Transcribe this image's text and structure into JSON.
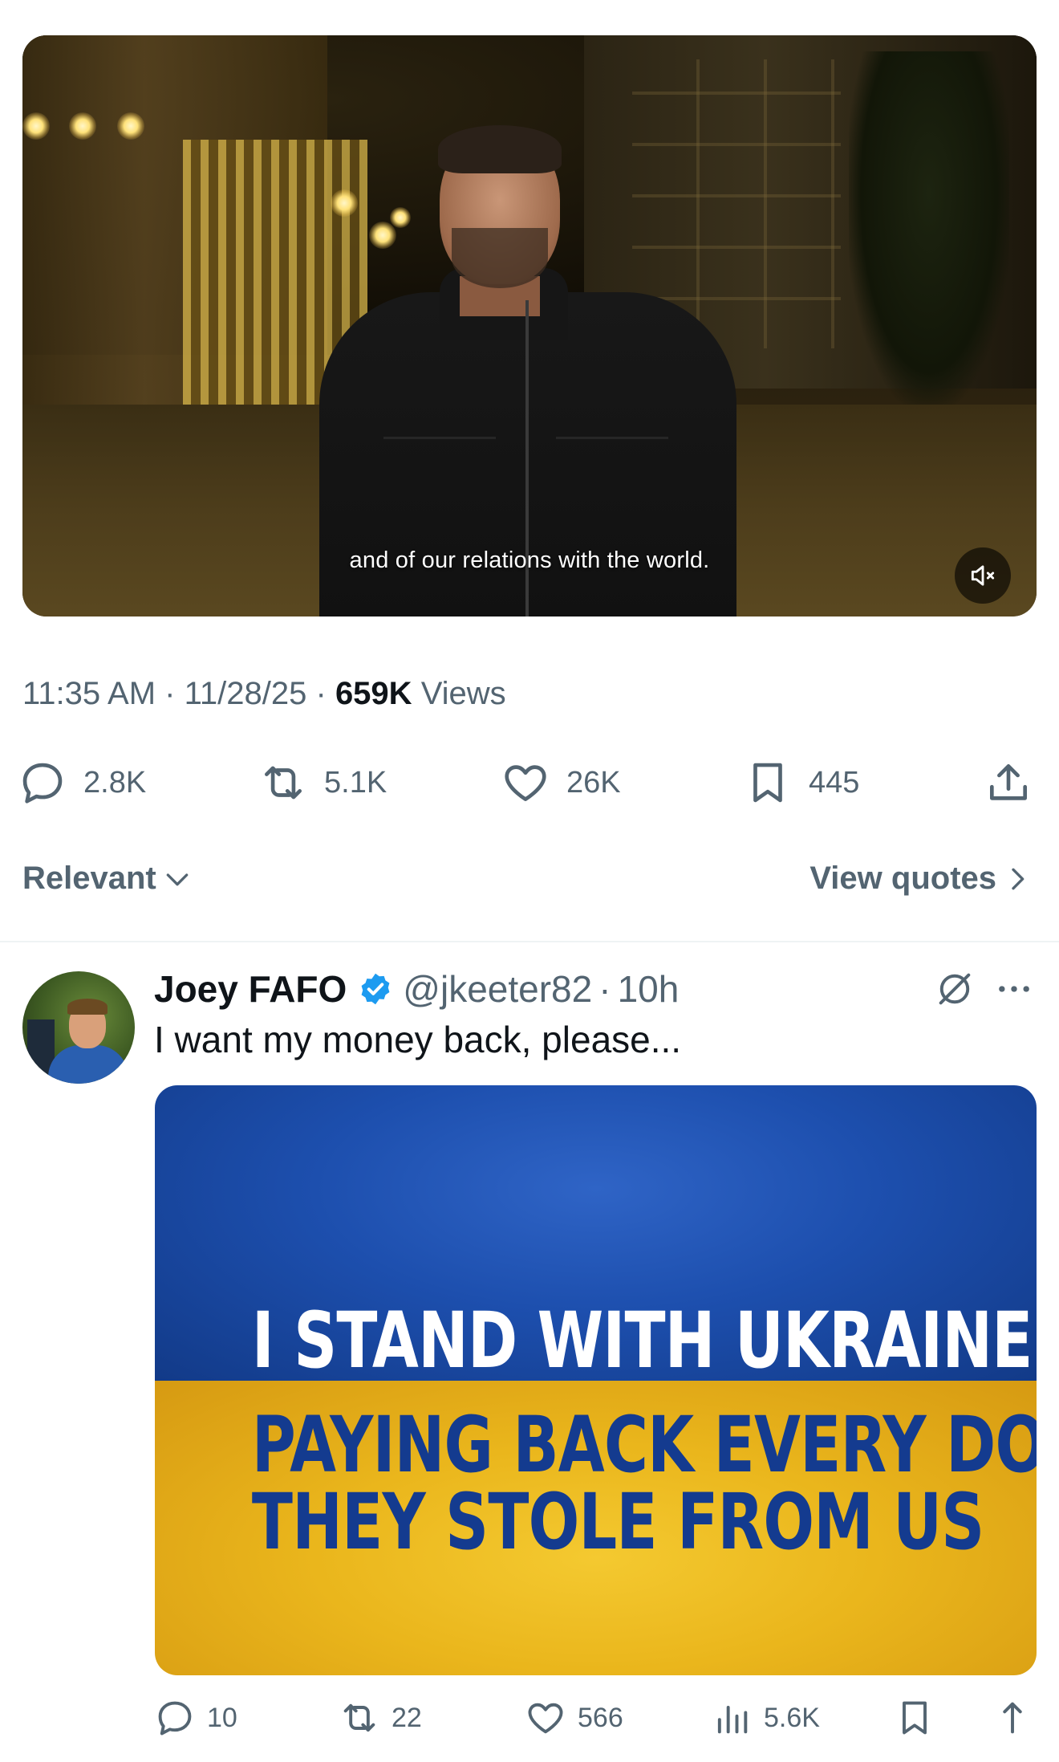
{
  "video": {
    "caption": "and of our relations with the world.",
    "mute_icon": "speaker-muted-icon"
  },
  "meta": {
    "time": "11:35 AM",
    "sep1": "·",
    "date": "11/28/25",
    "sep2": "·",
    "views_count": "659K",
    "views_label": "Views"
  },
  "actions": {
    "replies": "2.8K",
    "reposts": "5.1K",
    "likes": "26K",
    "bookmarks": "445"
  },
  "filter": {
    "sort_label": "Relevant",
    "view_quotes_label": "View quotes"
  },
  "reply": {
    "name": "Joey FAFO",
    "handle": "@jkeeter82",
    "sep": "·",
    "time": "10h",
    "text": "I want my money back, please...",
    "image": {
      "line1": "I STAND WITH UKRAINE",
      "line2": "PAYING BACK EVERY DOLLAR",
      "line3": "THEY STOLE FROM US"
    },
    "actions": {
      "replies": "10",
      "reposts": "22",
      "likes": "566",
      "views": "5.6K"
    }
  },
  "colors": {
    "muted_text": "#536471",
    "primary_text": "#0f1419",
    "verified_blue": "#1d9bf0",
    "flag_blue": "#1d4fae",
    "flag_yellow": "#eab61c"
  }
}
